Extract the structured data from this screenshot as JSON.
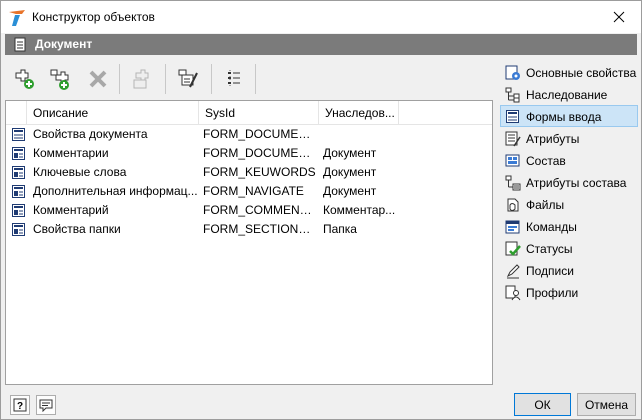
{
  "window": {
    "title": "Конструктор объектов"
  },
  "section": {
    "title": "Документ"
  },
  "table": {
    "columns": [
      "Описание",
      "SysId",
      "Унаследов..."
    ],
    "rows": [
      {
        "description": "Свойства документа",
        "sysid": "FORM_DOCUMENT...",
        "inherited": ""
      },
      {
        "description": "Комментарии",
        "sysid": "FORM_DOCUMENT...",
        "inherited": "Документ"
      },
      {
        "description": "Ключевые слова",
        "sysid": "FORM_KEUWORDS",
        "inherited": "Документ"
      },
      {
        "description": "Дополнительная информац...",
        "sysid": "FORM_NAVIGATE",
        "inherited": "Документ"
      },
      {
        "description": "Комментарий",
        "sysid": "FORM_COMMENT_...",
        "inherited": "Комментар..."
      },
      {
        "description": "Свойства папки",
        "sysid": "FORM_SECTION_PR...",
        "inherited": "Папка"
      }
    ]
  },
  "nav": {
    "items": [
      {
        "label": "Основные свойства",
        "icon": "properties-icon"
      },
      {
        "label": "Наследование",
        "icon": "inheritance-icon"
      },
      {
        "label": "Формы ввода",
        "icon": "input-form-icon",
        "selected": true
      },
      {
        "label": "Атрибуты",
        "icon": "attributes-icon"
      },
      {
        "label": "Состав",
        "icon": "composition-icon"
      },
      {
        "label": "Атрибуты состава",
        "icon": "composition-attributes-icon"
      },
      {
        "label": "Файлы",
        "icon": "files-icon"
      },
      {
        "label": "Команды",
        "icon": "commands-icon"
      },
      {
        "label": "Статусы",
        "icon": "statuses-icon"
      },
      {
        "label": "Подписи",
        "icon": "signatures-icon"
      },
      {
        "label": "Профили",
        "icon": "profiles-icon"
      }
    ]
  },
  "buttons": {
    "ok": "ОК",
    "cancel": "Отмена"
  },
  "colors": {
    "accent": "#0078d7",
    "header": "#7b7b7b",
    "selected": "#cce4f7",
    "add_green": "#2e9e2e"
  }
}
